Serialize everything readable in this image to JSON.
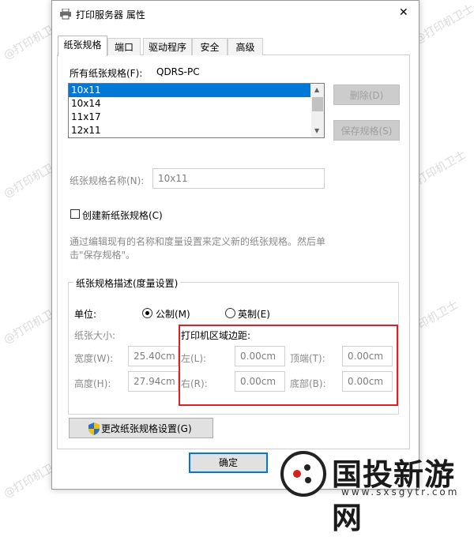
{
  "window": {
    "title": "打印服务器 属性",
    "close_label": "✕"
  },
  "tabs": [
    {
      "label": "纸张规格"
    },
    {
      "label": "端口"
    },
    {
      "label": "驱动程序"
    },
    {
      "label": "安全"
    },
    {
      "label": "高级"
    }
  ],
  "forms_section": {
    "label": "所有纸张规格(F):",
    "server": "QDRS-PC"
  },
  "forms_list": [
    "10x11",
    "10x14",
    "11x17",
    "12x11"
  ],
  "buttons": {
    "delete": "删除(D)",
    "save_form": "保存规格(S)",
    "change_settings": "更改纸张规格设置(G)",
    "ok": "确定"
  },
  "form_name": {
    "label": "纸张规格名称(N):",
    "value": "10x11"
  },
  "create_new": {
    "label": "创建新纸张规格(C)"
  },
  "hint": {
    "line1": "通过编辑现有的名称和度量设置来定义新的纸张规格。然后单",
    "line2": "击\"保存规格\"。"
  },
  "description_group": {
    "label": "纸张规格描述(度量设置)"
  },
  "units": {
    "label": "单位:",
    "metric": "公制(M)",
    "english": "英制(E)"
  },
  "paper_size": {
    "label": "纸张大小:",
    "width_label": "宽度(W):",
    "width_value": "25.40cm",
    "height_label": "高度(H):",
    "height_value": "27.94cm"
  },
  "margins": {
    "label": "打印机区域边距:",
    "left_label": "左(L):",
    "left_value": "0.00cm",
    "top_label": "顶端(T):",
    "top_value": "0.00cm",
    "right_label": "右(R):",
    "right_value": "0.00cm",
    "bottom_label": "底部(B):",
    "bottom_value": "0.00cm"
  },
  "watermark": {
    "text": "@打印机卫士"
  },
  "brand": {
    "name": "国投新游网",
    "url": "www.sxsgytr.com"
  },
  "colors": {
    "selection": "#0078d7",
    "highlight_box": "#e02020"
  }
}
